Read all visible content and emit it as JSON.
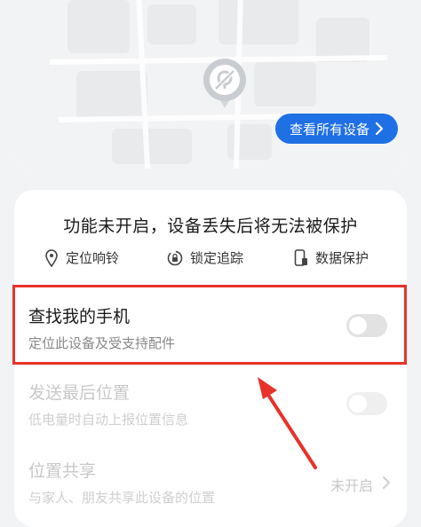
{
  "map_card": {
    "view_all_button": "查看所有设备",
    "pin_icon": "location-off-icon"
  },
  "protection": {
    "warning": "功能未开启，设备丢失后将无法被保护",
    "features": [
      {
        "icon": "location-pin-icon",
        "label": "定位响铃"
      },
      {
        "icon": "lock-track-icon",
        "label": "锁定追踪"
      },
      {
        "icon": "phone-backup-icon",
        "label": "数据保护"
      }
    ]
  },
  "settings": {
    "find_phone": {
      "title": "查找我的手机",
      "subtitle": "定位此设备及受支持配件",
      "enabled": false
    },
    "send_last_location": {
      "title": "发送最后位置",
      "subtitle": "低电量时自动上报位置信息",
      "enabled": false
    },
    "location_share": {
      "title": "位置共享",
      "subtitle": "与家人、朋友共享此设备的位置",
      "status": "未开启"
    }
  },
  "annotation": {
    "highlight_color": "#e8322a"
  }
}
